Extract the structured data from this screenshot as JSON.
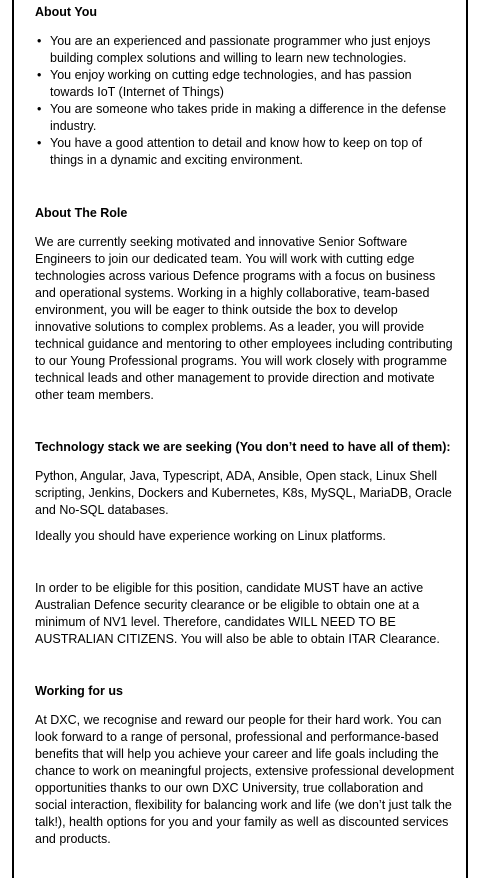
{
  "about_you": {
    "heading": "About You",
    "items": [
      "You are an experienced and passionate programmer who just enjoys building complex solutions and willing to learn new technologies.",
      "You enjoy working on cutting edge technologies, and has passion towards IoT (Internet of Things)",
      "You are someone who takes pride in making a difference in the defense industry.",
      "You have a good attention to detail and know how to keep on top of things in a dynamic and exciting environment."
    ]
  },
  "about_role": {
    "heading": "About The Role",
    "text": "We are currently seeking motivated and innovative Senior Software Engineers to join our dedicated team.  You will work with cutting edge technologies across various Defence programs with a focus on business and operational systems.  Working in a highly collaborative, team-based environment, you will be eager to think outside the box to develop innovative solutions to complex problems.  As a leader, you will provide technical guidance and mentoring to other employees including contributing to our Young Professional programs.   You will work closely with programme technical leads and other management to provide direction and motivate other team members."
  },
  "tech_stack": {
    "heading": "Technology stack we are seeking (You don’t need to have all of them):",
    "text": "Python, Angular, Java, Typescript, ADA, Ansible, Open stack, Linux Shell scripting, Jenkins, Dockers and Kubernetes, K8s, MySQL, MariaDB, Oracle and No-SQL databases.",
    "linux_note": "Ideally you should have experience working on Linux platforms."
  },
  "eligibility": {
    "text": "In order to be eligible for this position, candidate MUST have an active Australian Defence security clearance or be eligible to obtain one at a minimum of NV1 level.  Therefore, candidates WILL NEED TO BE AUSTRALIAN CITIZENS.  You will also be able to obtain ITAR Clearance."
  },
  "working_for_us": {
    "heading": "Working for us",
    "text": "At DXC, we recognise and reward our people for their hard work.  You can look forward to a range of personal, professional and performance-based benefits that will help you achieve your career and life goals including the chance to work on meaningful projects, extensive professional development opportunities thanks to our own DXC University, true collaboration and social interaction, flexibility for balancing work and life (we don’t just talk the talk!), health options for you and your family as well as discounted services and products."
  }
}
